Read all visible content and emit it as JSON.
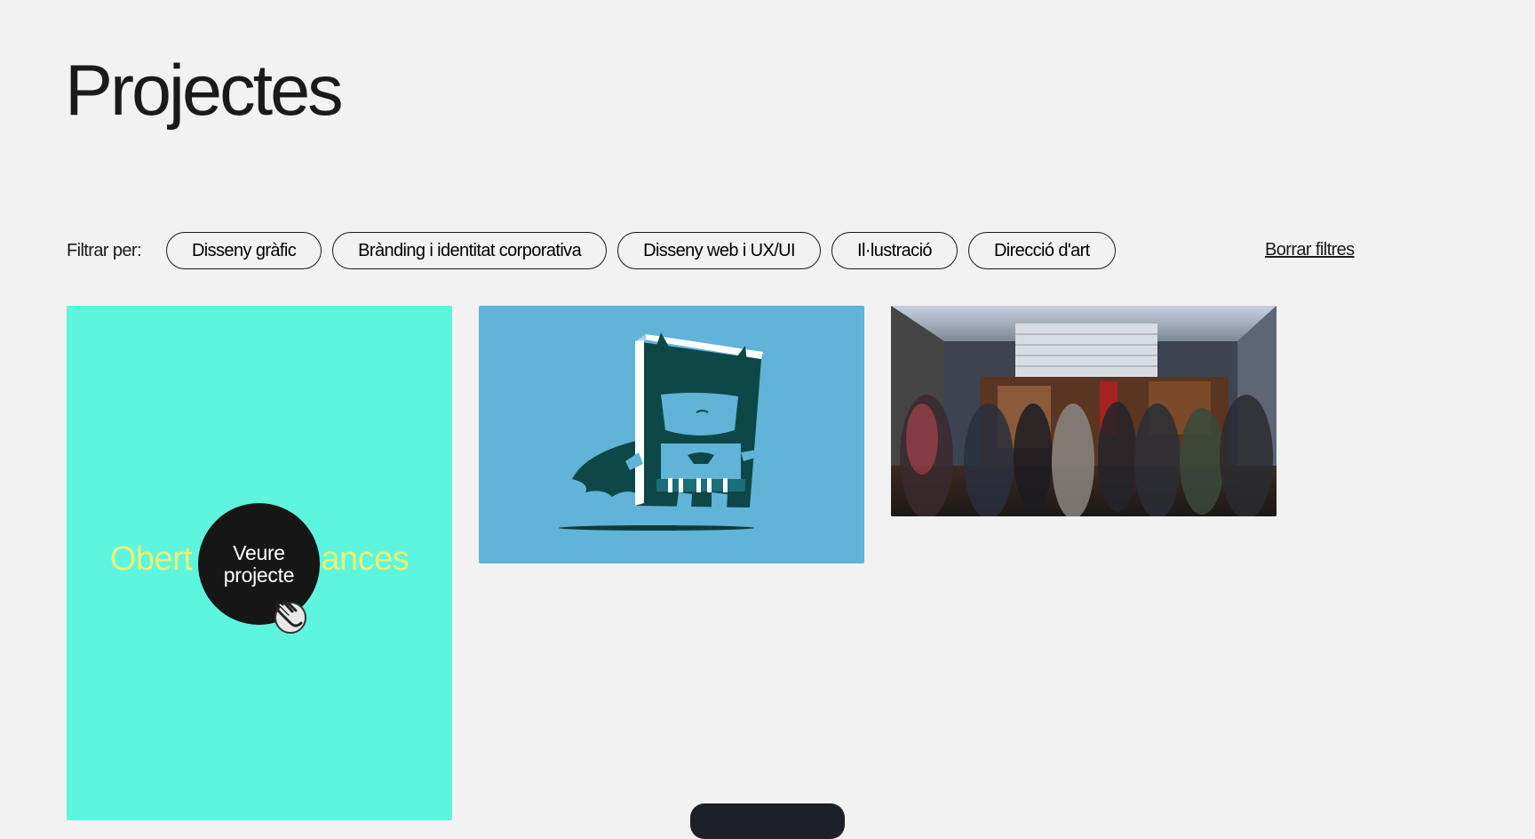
{
  "page": {
    "title": "Projectes"
  },
  "filters": {
    "label": "Filtrar per:",
    "chips": [
      "Disseny gràfic",
      "Brànding i identitat corporativa",
      "Disseny web i UX/UI",
      "Il·lustració",
      "Direcció d'art"
    ],
    "clear_label": "Borrar filtres"
  },
  "projects": [
    {
      "title_left": "Obert",
      "title_right": "ances",
      "hover_label_line1": "Veure",
      "hover_label_line2": "projecte",
      "background": "#5ef5de",
      "title_color": "#e8f07a"
    },
    {
      "background": "#61b3d8",
      "image_icon": "batman-book-illustration"
    },
    {
      "background": "#2e3440",
      "image_icon": "cinema-lobby-photo"
    }
  ],
  "dock": {
    "icon": "toolbar-dock"
  }
}
